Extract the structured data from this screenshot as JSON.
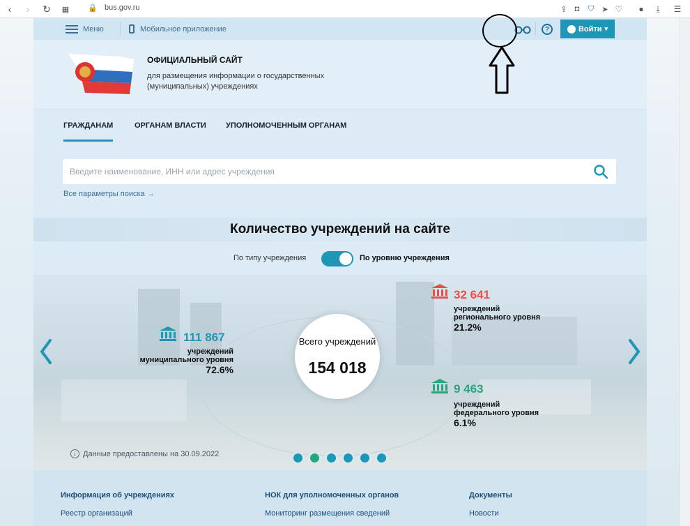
{
  "browser": {
    "url": "bus.gov.ru"
  },
  "topbar": {
    "menu_label": "Меню",
    "mobile_label": "Мобильное приложение",
    "help_symbol": "?",
    "login_label": "Войти",
    "chevron_symbol": "⌄"
  },
  "header": {
    "title": "ОФИЦИАЛЬНЫЙ САЙТ",
    "subtitle": "для размещения информации о государственных (муниципальных) учреждениях"
  },
  "nav": [
    {
      "label": "ГРАЖДАНАМ",
      "active": true
    },
    {
      "label": "ОРГАНАМ ВЛАСТИ",
      "active": false
    },
    {
      "label": "УПОЛНОМОЧЕННЫМ ОРГАНАМ",
      "active": false
    }
  ],
  "search": {
    "placeholder": "Введите наименование, ИНН или адрес учреждения",
    "advanced_link": "Все параметры поиска →"
  },
  "stats": {
    "title": "Количество учреждений на сайте",
    "toggle_left": "По типу учреждения",
    "toggle_right": "По уровню учреждения",
    "toggle_on": true,
    "total_label": "Всего учреждений",
    "total_value": "154 018",
    "municipal": {
      "value": "111 867",
      "label": "учреждений муниципального уровня",
      "pct": "72.6%",
      "color": "#1e97b6"
    },
    "regional": {
      "value": "32 641",
      "label": "учреждений регионального уровня",
      "pct": "21.2%",
      "color": "#e8504a"
    },
    "federal": {
      "value": "9 463",
      "label": "учреждений федерального уровня",
      "pct": "6.1%",
      "color": "#25a77b"
    },
    "data_note": "Данные предоставлены на 30.09.2022",
    "info_symbol": "i",
    "slides": 6,
    "active_slide": 1
  },
  "footer": {
    "columns": [
      {
        "head": "Информация об учреждениях",
        "link": "Реестр организаций"
      },
      {
        "head": "НОК для уполномоченных органов",
        "link": "Мониторинг размещения сведений"
      },
      {
        "head": "Документы",
        "link": "Новости"
      }
    ]
  },
  "colors": {
    "accent": "#1e97b6",
    "regional": "#e8504a",
    "federal": "#25a77b"
  }
}
